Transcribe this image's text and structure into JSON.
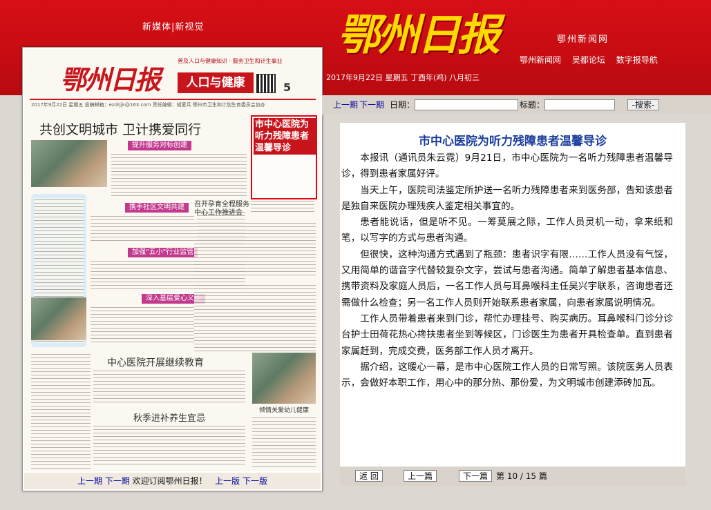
{
  "header": {
    "slogan": "新媒体|新视觉",
    "logo_text": "鄂州日报",
    "site_name": "鄂州新闻网",
    "nav_links": [
      "鄂州新闻网",
      "吴都论坛",
      "数字报导航"
    ],
    "date_line": "2017年9月22日 星期五 丁酉年(鸡) 八月初三"
  },
  "paper": {
    "logo_text": "鄂州日报",
    "tagline": "普及人口与健康知识 · 服务卫生和计生事业",
    "section_name": "人口与健康",
    "page_number": "5",
    "info_line": "2017年9月22日   星期五       投稿邮箱：ezdrjjk@163.com     责任编辑：胡爱兵      鄂州市卫生和计划生育委员会协办",
    "headline": "共创文明城市  卫计携爱同行",
    "highlight": "市中心医院为听力残障患者温馨导诊",
    "subheads": [
      "提升服务对标创建",
      "携手社区文明共建",
      "加强\"五小\"行业监管",
      "深入基层爱心义诊"
    ],
    "section_heads": [
      "召开孕育全程服务中心工作推进会",
      "中心医院开展继续教育",
      "秋季进补养生宜忌",
      "倾情关爱幼儿健康"
    ],
    "footer": {
      "prev_period": "上一期",
      "next_period": "下一期",
      "welcome": "欢迎订阅鄂州日报！",
      "prev_page": "上一版",
      "next_page": "下一版"
    }
  },
  "search": {
    "prev_period": "上一期",
    "next_period": "下一期",
    "date_label": "日期：",
    "date_value": "",
    "title_label": "标题：",
    "title_value": "",
    "search_button": "-搜索-"
  },
  "article": {
    "title": "市中心医院为听力残障患者温馨导诊",
    "paragraphs": [
      "本报讯（通讯员朱云霓）9月21日，市中心医院为一名听力残障患者温馨导诊，得到患者家属好评。",
      "当天上午，医院司法鉴定所护送一名听力残障患者来到医务部，告知该患者是独自来医院办理残疾人鉴定相关事宜的。",
      "患者能说话，但是听不见。一筹莫展之际，工作人员灵机一动，拿来纸和笔，以写字的方式与患者沟通。",
      "但很快，这种沟通方式遇到了瓶颈：患者识字有限……工作人员没有气馁，又用简单的谐音字代替较复杂文字，尝试与患者沟通。简单了解患者基本信息、携带资料及家庭人员后，一名工作人员与耳鼻喉科主任吴兴宇联系，咨询患者还需做什么检查；另一名工作人员则开始联系患者家属，向患者家属说明情况。",
      "工作人员带着患者来到门诊，帮忙办理挂号、购买病历。耳鼻喉科门诊分诊台护士田荷花热心搀扶患者坐到等候区，门诊医生为患者开具检查单。直到患者家属赶到，完成交费，医务部工作人员才离开。",
      "据介绍，这暖心一幕，是市中心医院工作人员的日常写照。该院医务人员表示，会做好本职工作，用心中的那分热、那份爱，为文明城市创建添砖加瓦。"
    ]
  },
  "pager": {
    "back_button": "返 回",
    "prev_button": "上一篇",
    "next_button": "下一篇",
    "page_info": "第 10 / 15 篇"
  },
  "colors": {
    "header_red": "#d70f16",
    "logo_yellow": "#ffd900",
    "title_blue": "#1a3d9c",
    "link_blue": "#00009c",
    "highlight_red": "#e60012"
  }
}
